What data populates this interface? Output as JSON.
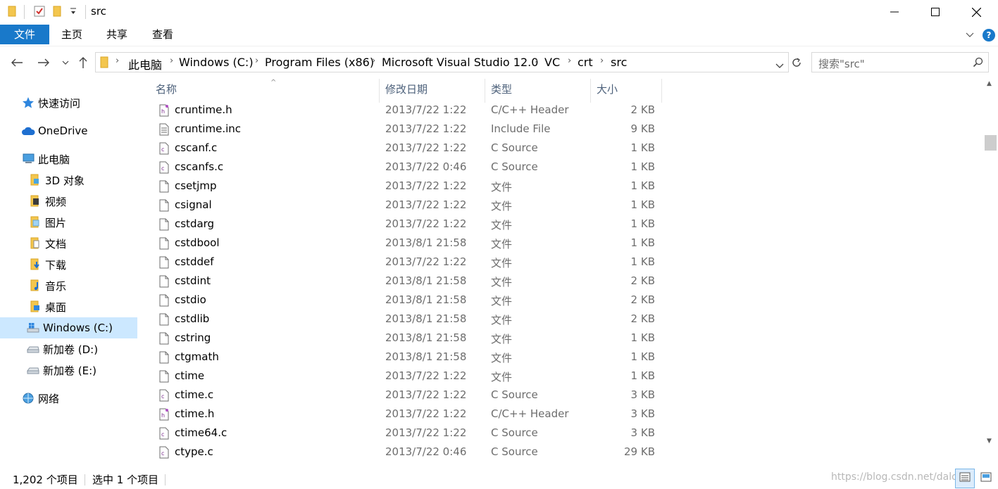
{
  "window": {
    "title": "src"
  },
  "ribbon": {
    "tabs": [
      "文件",
      "主页",
      "共享",
      "查看"
    ]
  },
  "address": {
    "crumbs": [
      "此电脑",
      "Windows (C:)",
      "Program Files (x86)",
      "Microsoft Visual Studio 12.0",
      "VC",
      "crt",
      "src"
    ]
  },
  "search": {
    "placeholder": "搜索\"src\""
  },
  "sidebar": {
    "items": [
      {
        "label": "快速访问",
        "icon": "star-icon"
      },
      {
        "label": "OneDrive",
        "icon": "cloud-icon"
      },
      {
        "label": "此电脑",
        "icon": "computer-icon"
      },
      {
        "label": "3D 对象",
        "icon": "3d-objects-icon"
      },
      {
        "label": "视频",
        "icon": "video-folder-icon"
      },
      {
        "label": "图片",
        "icon": "pictures-folder-icon"
      },
      {
        "label": "文档",
        "icon": "documents-folder-icon"
      },
      {
        "label": "下载",
        "icon": "downloads-folder-icon"
      },
      {
        "label": "音乐",
        "icon": "music-folder-icon"
      },
      {
        "label": "桌面",
        "icon": "desktop-folder-icon"
      },
      {
        "label": "Windows (C:)",
        "icon": "windows-drive-icon"
      },
      {
        "label": "新加卷 (D:)",
        "icon": "drive-icon"
      },
      {
        "label": "新加卷 (E:)",
        "icon": "drive-icon"
      },
      {
        "label": "网络",
        "icon": "network-icon"
      }
    ]
  },
  "columns": {
    "name": "名称",
    "date": "修改日期",
    "type": "类型",
    "size": "大小"
  },
  "files": [
    {
      "name": "cruntime.h",
      "date": "2013/7/22 1:22",
      "type": "C/C++ Header",
      "size": "2 KB",
      "icon": "header-file-icon"
    },
    {
      "name": "cruntime.inc",
      "date": "2013/7/22 1:22",
      "type": "Include File",
      "size": "9 KB",
      "icon": "text-file-icon"
    },
    {
      "name": "cscanf.c",
      "date": "2013/7/22 1:22",
      "type": "C Source",
      "size": "1 KB",
      "icon": "c-source-icon"
    },
    {
      "name": "cscanfs.c",
      "date": "2013/7/22 0:46",
      "type": "C Source",
      "size": "1 KB",
      "icon": "c-source-icon"
    },
    {
      "name": "csetjmp",
      "date": "2013/7/22 1:22",
      "type": "文件",
      "size": "1 KB",
      "icon": "blank-file-icon"
    },
    {
      "name": "csignal",
      "date": "2013/7/22 1:22",
      "type": "文件",
      "size": "1 KB",
      "icon": "blank-file-icon"
    },
    {
      "name": "cstdarg",
      "date": "2013/7/22 1:22",
      "type": "文件",
      "size": "1 KB",
      "icon": "blank-file-icon"
    },
    {
      "name": "cstdbool",
      "date": "2013/8/1 21:58",
      "type": "文件",
      "size": "1 KB",
      "icon": "blank-file-icon"
    },
    {
      "name": "cstddef",
      "date": "2013/7/22 1:22",
      "type": "文件",
      "size": "1 KB",
      "icon": "blank-file-icon"
    },
    {
      "name": "cstdint",
      "date": "2013/8/1 21:58",
      "type": "文件",
      "size": "2 KB",
      "icon": "blank-file-icon"
    },
    {
      "name": "cstdio",
      "date": "2013/8/1 21:58",
      "type": "文件",
      "size": "2 KB",
      "icon": "blank-file-icon"
    },
    {
      "name": "cstdlib",
      "date": "2013/8/1 21:58",
      "type": "文件",
      "size": "2 KB",
      "icon": "blank-file-icon"
    },
    {
      "name": "cstring",
      "date": "2013/8/1 21:58",
      "type": "文件",
      "size": "1 KB",
      "icon": "blank-file-icon"
    },
    {
      "name": "ctgmath",
      "date": "2013/8/1 21:58",
      "type": "文件",
      "size": "1 KB",
      "icon": "blank-file-icon"
    },
    {
      "name": "ctime",
      "date": "2013/7/22 1:22",
      "type": "文件",
      "size": "1 KB",
      "icon": "blank-file-icon"
    },
    {
      "name": "ctime.c",
      "date": "2013/7/22 1:22",
      "type": "C Source",
      "size": "3 KB",
      "icon": "c-source-icon"
    },
    {
      "name": "ctime.h",
      "date": "2013/7/22 1:22",
      "type": "C/C++ Header",
      "size": "3 KB",
      "icon": "header-file-icon"
    },
    {
      "name": "ctime64.c",
      "date": "2013/7/22 1:22",
      "type": "C Source",
      "size": "3 KB",
      "icon": "c-source-icon"
    },
    {
      "name": "ctype.c",
      "date": "2013/7/22 0:46",
      "type": "C Source",
      "size": "29 KB",
      "icon": "c-source-icon"
    }
  ],
  "status": {
    "item_count": "1,202 个项目",
    "selected": "选中 1 个项目"
  },
  "watermark": "https://blog.csdn.net/dalong",
  "colors": {
    "accent": "#1979ca",
    "selection": "#cce8ff",
    "header_text": "#4c607a",
    "meta_text": "#6d6d6d"
  }
}
